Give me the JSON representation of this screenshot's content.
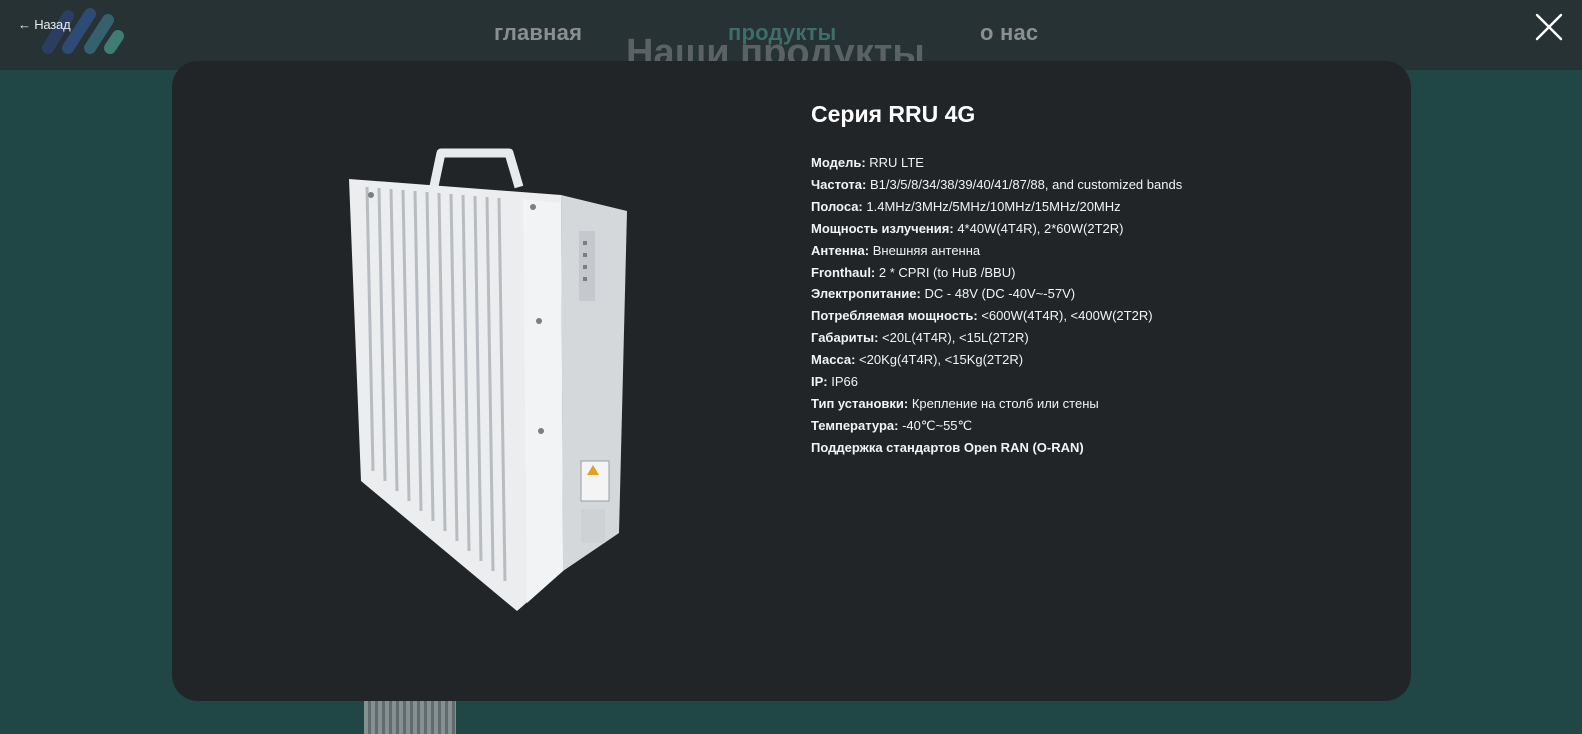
{
  "header": {
    "back_label": "← Назад",
    "nav": [
      "главная",
      "продукты",
      "о нас"
    ],
    "background_title": "Наши продукты",
    "close_icon": "close-icon",
    "colors": {
      "topbar": "#263234",
      "page_background": "#204745",
      "active_nav": "#3f6d69",
      "inactive_nav": "#8b8f90",
      "logo_dark": "#2e4b75",
      "logo_teal": "#3f7d74"
    }
  },
  "modal": {
    "title": "Серия RRU 4G",
    "background": "#222528",
    "image_icon": "rru-device-image",
    "specs": [
      {
        "label": "Модель:",
        "value": " RRU LTE"
      },
      {
        "label": "Частота:",
        "value": " B1/3/5/8/34/38/39/40/41/87/88, and customized bands"
      },
      {
        "label": "Полоса:",
        "value": " 1.4MHz/3MHz/5MHz/10MHz/15MHz/20MHz"
      },
      {
        "label": "Мощность излучения:",
        "value": " 4*40W(4T4R), 2*60W(2T2R)"
      },
      {
        "label": "Антенна:",
        "value": " Внешняя антенна"
      },
      {
        "label": "Fronthaul:",
        "value": " 2 * CPRI (to HuB /BBU)"
      },
      {
        "label": "Электропитание:",
        "value": " DC - 48V (DC -40V~-57V)"
      },
      {
        "label": "Потребляемая мощность:",
        "value": " <600W(4T4R), <400W(2T2R)"
      },
      {
        "label": "Габариты:",
        "value": " <20L(4T4R), <15L(2T2R)"
      },
      {
        "label": "Масса:",
        "value": " <20Kg(4T4R), <15Kg(2T2R)"
      },
      {
        "label": "IP:",
        "value": " IP66"
      },
      {
        "label": "Тип установки:",
        "value": " Крепление на столб или стены"
      },
      {
        "label": "Температура:",
        "value": " -40℃~55℃"
      },
      {
        "label": "Поддержка стандартов Open RAN (O-RAN)",
        "value": ""
      }
    ]
  }
}
